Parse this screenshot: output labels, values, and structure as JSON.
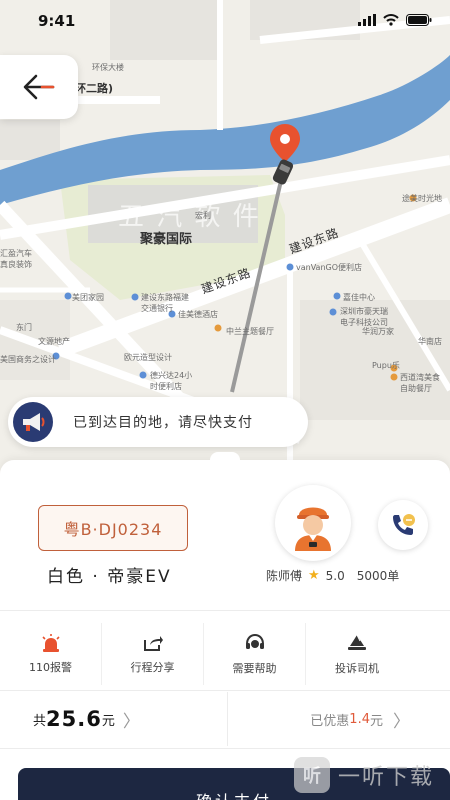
{
  "status_bar": {
    "time": "9:41"
  },
  "map": {
    "labels": {
      "road_ring": "环二路)",
      "road_jianshe_east": "建设东路",
      "road_jianshe_east_2": "建设东路",
      "building_juhao": "聚豪国际",
      "watermark": "五 汽 软 件",
      "poi_huanbao": "环保大楼",
      "poi_hongli": "宏利",
      "poi_huiying_auto": "汇盈汽车\n真良装饰",
      "poi_meilan": "美团家园",
      "poi_jianshe_bank": "建设东路福建\n交通银行",
      "poi_jiamei": "佳美德酒店",
      "poi_vanvango": "vanVanGO便利店",
      "poi_peicheng": "嘉佳中心",
      "poi_shenzhen_tianyu": "深圳市豪天瑞\n电子科技公司",
      "poi_huarun": "华润万家",
      "poi_huanan": "华南店",
      "poi_dongmen": "东门",
      "poi_wenyuan": "文源地产",
      "poi_jiaoyun": "欧元造型设计",
      "poi_24h": "德兴达24小\n时便利店",
      "poi_zhonglan": "中兰主题餐厅",
      "poi_pupu": "Pupu乐",
      "poi_food": "西道湾美食\n自助餐厅",
      "poi_tushan": "途美时光地",
      "poi_design": "美国商务之设计"
    }
  },
  "notice": {
    "text": "已到达目的地，请尽快支付"
  },
  "trip": {
    "plate": "粤B·DJ0234",
    "car_desc": "白色 · 帝豪EV",
    "driver_name": "陈师傅",
    "rating": "5.0",
    "orders": "5000单"
  },
  "actions": [
    {
      "label": "110报警",
      "icon": "alarm-icon"
    },
    {
      "label": "行程分享",
      "icon": "share-icon"
    },
    {
      "label": "需要帮助",
      "icon": "headset-icon"
    },
    {
      "label": "投诉司机",
      "icon": "complaint-icon"
    }
  ],
  "fare": {
    "prefix": "共",
    "amount": "25.6",
    "unit": "元",
    "discount_label": "已优惠",
    "discount_amount": "1.4",
    "discount_unit": "元"
  },
  "confirm_label": "确认支付",
  "watermark": {
    "logo": "听",
    "text": "一听下载"
  },
  "colors": {
    "brand_dark": "#1d2741",
    "plate_accent": "#c0603b",
    "discount": "#e05a3a",
    "river": "#6f9fd0",
    "pin": "#e8522f",
    "star": "#f2b01e"
  }
}
